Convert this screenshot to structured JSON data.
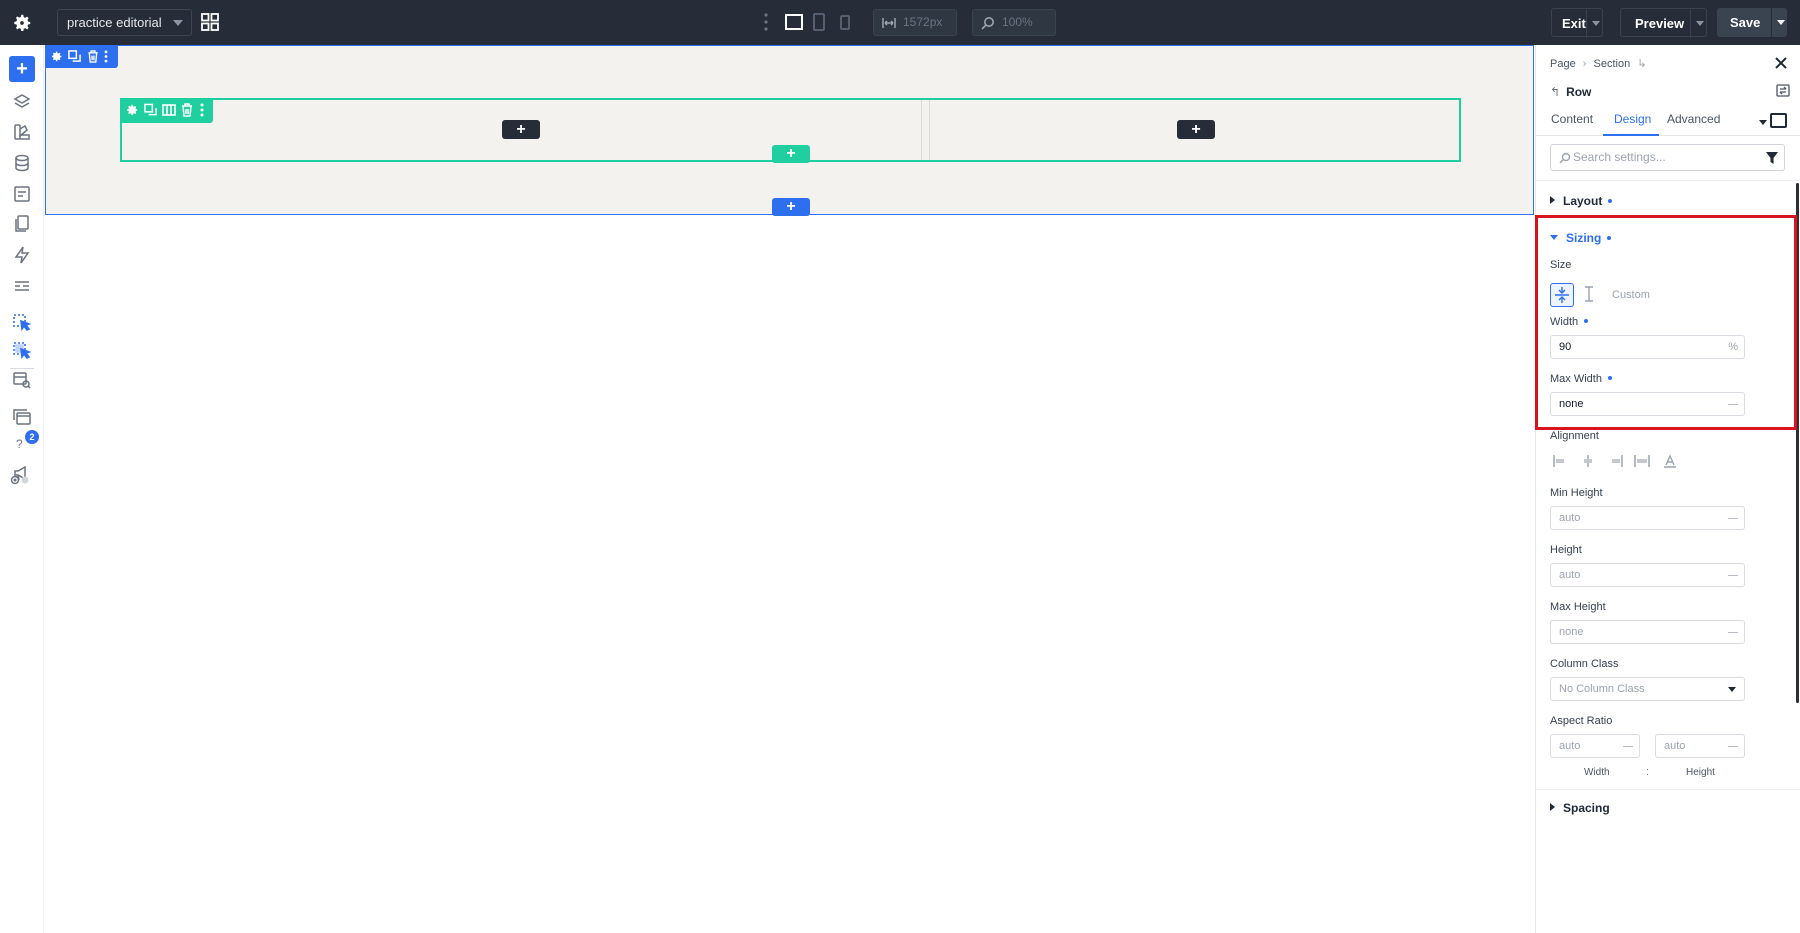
{
  "topbar": {
    "page_select": "practice editorial",
    "width_readout": "1572px",
    "zoom_readout": "100%",
    "exit_label": "Exit",
    "preview_label": "Preview",
    "save_label": "Save"
  },
  "rail": {
    "add_label": "+",
    "help_label": "?",
    "notification_count": "2"
  },
  "canvas": {
    "add_glyph": "+"
  },
  "panel": {
    "breadcrumb": [
      "Page",
      "›",
      "Section",
      "↳"
    ],
    "element_title": "Row",
    "back_glyph": "↰",
    "tabs": [
      "Content",
      "Design",
      "Advanced"
    ],
    "active_tab": "Design",
    "search_placeholder": "Search settings...",
    "groups": {
      "layout": "Layout",
      "sizing": "Sizing",
      "spacing": "Spacing"
    },
    "sizing": {
      "size_label": "Size",
      "custom_label": "Custom",
      "width_label": "Width",
      "width_value": "90",
      "width_unit": "%",
      "max_width_label": "Max Width",
      "max_width_value": "none",
      "alignment_label": "Alignment",
      "min_height_label": "Min Height",
      "min_height_placeholder": "auto",
      "height_label": "Height",
      "height_placeholder": "auto",
      "max_height_label": "Max Height",
      "max_height_placeholder": "none",
      "column_class_label": "Column Class",
      "column_class_value": "No Column Class",
      "aspect_ratio_label": "Aspect Ratio",
      "aspect_width_placeholder": "auto",
      "aspect_height_placeholder": "auto",
      "aspect_width_sub": "Width",
      "aspect_height_sub": "Height",
      "aspect_sep": ":"
    }
  },
  "colors": {
    "topbar": "#262d38",
    "accent_blue": "#2e6ff0",
    "row_green": "#1fcf9f",
    "section_bg": "#f3f2ee",
    "highlight_red": "#d9141e"
  }
}
